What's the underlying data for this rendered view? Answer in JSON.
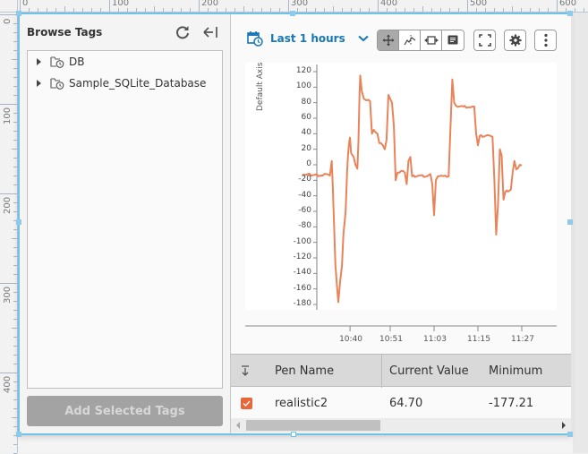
{
  "rulers": {
    "top_labels": [
      "0",
      "100",
      "200",
      "300",
      "400",
      "500",
      "600"
    ],
    "left_labels": [
      "0",
      "100",
      "200",
      "300",
      "400"
    ]
  },
  "browse": {
    "title": "Browse Tags",
    "refresh_icon": "refresh-icon",
    "collapse_icon": "collapse-left-icon",
    "tree": [
      {
        "label": "DB",
        "icon": "folder-history-icon"
      },
      {
        "label": "Sample_SQLite_Database",
        "icon": "folder-history-icon"
      }
    ],
    "add_button": "Add Selected Tags"
  },
  "toolbar": {
    "range_icon": "calendar-clock-icon",
    "range_label": "Last 1 hours",
    "range_chevron": "chevron-down-icon",
    "tools": [
      {
        "name": "pan-icon",
        "active": true
      },
      {
        "name": "x-trace-icon",
        "active": false
      },
      {
        "name": "zoom-horizontal-icon",
        "active": false
      },
      {
        "name": "annotation-icon",
        "active": false
      }
    ],
    "fullscreen_icon": "fullscreen-icon",
    "settings_icon": "gear-icon",
    "menu_icon": "kebab-menu-icon"
  },
  "chart_data": {
    "type": "line",
    "title": "",
    "xlabel": "",
    "ylabel": "Default Axis",
    "ylim": [
      -185,
      125
    ],
    "yticks": [
      120,
      100,
      80,
      60,
      40,
      20,
      0,
      -20,
      -40,
      -60,
      -80,
      -100,
      -120,
      -140,
      -160,
      -180
    ],
    "xticks": [
      "10:40",
      "10:51",
      "11:03",
      "11:15",
      "11:27"
    ],
    "xlim_minutes": [
      0,
      60
    ],
    "xtick_positions_minutes": [
      13,
      24,
      36,
      48,
      60
    ],
    "grid": false,
    "legend": "none",
    "series": [
      {
        "name": "realistic2",
        "color": "#e8835a",
        "points": [
          [
            0,
            -12
          ],
          [
            5.5,
            -14
          ],
          [
            6.5,
            -12
          ],
          [
            7.5,
            -14
          ],
          [
            8,
            5
          ],
          [
            8.3,
            -30
          ],
          [
            9,
            -130
          ],
          [
            9.5,
            -160
          ],
          [
            9.8,
            -177
          ],
          [
            10.3,
            -150
          ],
          [
            10.8,
            -130
          ],
          [
            11.2,
            -90
          ],
          [
            11.8,
            -60
          ],
          [
            12.2,
            -10
          ],
          [
            12.5,
            15
          ],
          [
            12.8,
            30
          ],
          [
            13,
            35
          ],
          [
            13.3,
            15
          ],
          [
            14,
            10
          ],
          [
            14.5,
            0
          ],
          [
            15,
            -5
          ],
          [
            15.3,
            30
          ],
          [
            15.6,
            90
          ],
          [
            15.8,
            115
          ],
          [
            16.2,
            95
          ],
          [
            16.8,
            85
          ],
          [
            17.5,
            83
          ],
          [
            18.5,
            82
          ],
          [
            19,
            40
          ],
          [
            19.5,
            45
          ],
          [
            20.5,
            40
          ],
          [
            21,
            28
          ],
          [
            22,
            25
          ],
          [
            22.5,
            20
          ],
          [
            23,
            32
          ],
          [
            23.5,
            90
          ],
          [
            24,
            85
          ],
          [
            24.5,
            80
          ],
          [
            25,
            50
          ],
          [
            25.5,
            -20
          ],
          [
            26,
            -10
          ],
          [
            27,
            -8
          ],
          [
            28,
            -10
          ],
          [
            28.5,
            -25
          ],
          [
            29,
            5
          ],
          [
            29.5,
            10
          ],
          [
            30,
            -15
          ],
          [
            32,
            -14
          ],
          [
            34,
            -15
          ],
          [
            35,
            -12
          ],
          [
            35.5,
            -25
          ],
          [
            36,
            -65
          ],
          [
            36.5,
            -20
          ],
          [
            37,
            -15
          ],
          [
            38,
            -14
          ],
          [
            39,
            -14
          ],
          [
            40,
            -15
          ],
          [
            40.5,
            50
          ],
          [
            41,
            110
          ],
          [
            41.5,
            80
          ],
          [
            42,
            76
          ],
          [
            44,
            75
          ],
          [
            46,
            74
          ],
          [
            47,
            75
          ],
          [
            47.5,
            40
          ],
          [
            48,
            25
          ],
          [
            48.5,
            37
          ],
          [
            50,
            37
          ],
          [
            51,
            38
          ],
          [
            52,
            36
          ],
          [
            52.5,
            -20
          ],
          [
            53,
            -90
          ],
          [
            53.5,
            -50
          ],
          [
            54,
            20
          ],
          [
            54.5,
            12
          ],
          [
            55,
            -45
          ],
          [
            55.5,
            -35
          ],
          [
            57,
            -32
          ],
          [
            57.5,
            -10
          ],
          [
            58,
            5
          ],
          [
            58.5,
            -6
          ],
          [
            59,
            -4
          ],
          [
            59.5,
            0
          ],
          [
            60,
            -1
          ]
        ]
      }
    ]
  },
  "table": {
    "sort_icon": "sort-arrow-icon",
    "columns": [
      "Pen Name",
      "Current Value",
      "Minimum"
    ],
    "rows": [
      {
        "checked": true,
        "pen_name": "realistic2",
        "current_value": "64.70",
        "minimum": "-177.21"
      }
    ]
  }
}
